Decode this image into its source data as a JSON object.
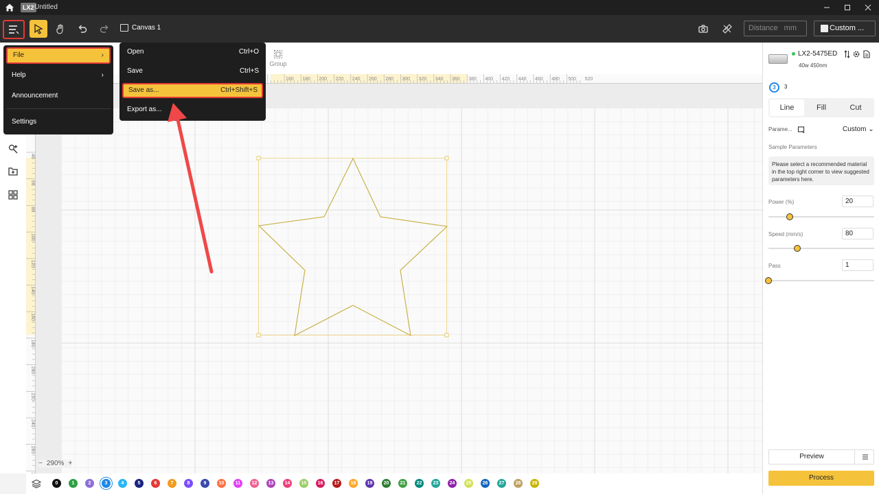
{
  "titlebar": {
    "logo": "LX2",
    "title": "Untitled"
  },
  "toolbar": {
    "canvas_label": "Canvas 1",
    "distance_placeholder": "Distance",
    "distance_unit": "mm",
    "device_select": "Custom ..."
  },
  "subbar": {
    "group_label": "Group"
  },
  "ruler": {
    "top_ticks": [
      "160",
      "180",
      "200",
      "220",
      "240",
      "260",
      "280",
      "300",
      "320",
      "340",
      "360",
      "380",
      "400",
      "420",
      "440",
      "460",
      "480",
      "500",
      "520"
    ],
    "left_ticks": [
      "40",
      "60",
      "80",
      "100",
      "120",
      "140",
      "160",
      "180",
      "200",
      "220",
      "240",
      "260",
      "280"
    ]
  },
  "zoom": {
    "minus": "−",
    "value": "290%",
    "plus": "+"
  },
  "layers": {
    "numbers": [
      "0",
      "1",
      "2",
      "3",
      "4",
      "5",
      "6",
      "7",
      "8",
      "9",
      "10",
      "11",
      "12",
      "13",
      "14",
      "15",
      "16",
      "17",
      "18",
      "19",
      "20",
      "21",
      "22",
      "23",
      "24",
      "25",
      "26",
      "27",
      "28",
      "29"
    ],
    "colors": [
      "#111111",
      "#2ea043",
      "#8e6fd8",
      "#1e88e5",
      "#29b6f6",
      "#1a237e",
      "#e53935",
      "#f29b1d",
      "#7c4dff",
      "#3949ab",
      "#ff7043",
      "#e040fb",
      "#f06292",
      "#ab47bc",
      "#ec407a",
      "#9ccc65",
      "#d81b60",
      "#b71c1c",
      "#ffa726",
      "#5e35b1",
      "#2e7d32",
      "#43a047",
      "#00897b",
      "#26a69a",
      "#8e24aa",
      "#d4e157",
      "#1565c0",
      "#26a69a",
      "#c0a060",
      "#c8b400"
    ]
  },
  "device": {
    "name": "LX2-5475ED",
    "sub": "40w 450nm",
    "layer_badge": "3",
    "layer_num": "3"
  },
  "process_tabs": {
    "line": "Line",
    "fill": "Fill",
    "cut": "Cut"
  },
  "params": {
    "label": "Parame...",
    "mode": "Custom",
    "sample_label": "Sample Parameters",
    "sample_info": "Please select a recommended material in the top right corner to view suggested parameters here.",
    "power_label": "Power  (%)",
    "power_value": "20",
    "power_fraction": 0.2,
    "speed_label": "Speed  (mm/s)",
    "speed_value": "80",
    "speed_fraction": 0.27,
    "pass_label": "Pass",
    "pass_value": "1",
    "pass_fraction": 0.0
  },
  "actions": {
    "preview": "Preview",
    "process": "Process"
  },
  "main_menu": {
    "file": "File",
    "help": "Help",
    "announcement": "Announcement",
    "settings": "Settings"
  },
  "file_menu": {
    "open": "Open",
    "open_sc": "Ctrl+O",
    "save": "Save",
    "save_sc": "Ctrl+S",
    "save_as": "Save as...",
    "save_as_sc": "Ctrl+Shift+S",
    "export": "Export as..."
  }
}
